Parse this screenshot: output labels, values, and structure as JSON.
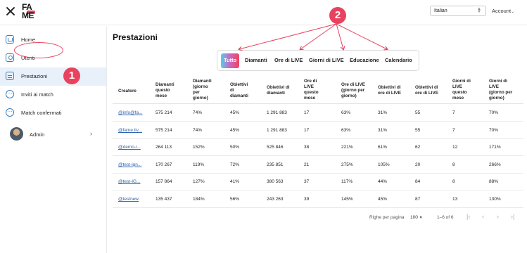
{
  "topbar": {
    "logo_line1": "FA",
    "logo_line2": "ME",
    "language_value": "Italian",
    "account_label": "Account"
  },
  "sidebar": {
    "items": [
      {
        "label": "Home",
        "icon": "home-icon"
      },
      {
        "label": "Utenti",
        "icon": "user-icon"
      },
      {
        "label": "Prestazioni",
        "icon": "document-icon"
      },
      {
        "label": "Inviti ai match",
        "icon": "chat-icon"
      },
      {
        "label": "Match confermati",
        "icon": "chat-icon"
      }
    ],
    "active_index": 2,
    "admin_label": "Admin"
  },
  "main": {
    "title": "Prestazioni",
    "tabs": [
      "Tutto",
      "Diamanti",
      "Ore di LIVE",
      "Giorni di LIVE",
      "Educazione",
      "Calendario"
    ],
    "active_tab": 0,
    "table": {
      "headers": [
        "Creatore",
        "Diamanti\nquesto\nmese",
        "Diamanti\n(giorno\nper\ngiorno)",
        "Obiettivi\ndi\ndiamanti",
        "Obiettivi di\ndiamanti",
        "Ore di\nLIVE\nquesto\nmese",
        "Ore di LIVE\n(giorno per\ngiorno)",
        "Obiettivi di\nore di LIVE",
        "Obiettivi di\nore di LIVE",
        "Giorni di\nLIVE\nquesto\nmese",
        "Giorni di\nLIVE\n(giorno per\ngiorno)"
      ],
      "rows": [
        [
          "@info@fa...",
          "575 214",
          "74%",
          "45%",
          "1 291 883",
          "17",
          "63%",
          "31%",
          "55",
          "7",
          "70%"
        ],
        [
          "@fame.liv...",
          "575 214",
          "74%",
          "45%",
          "1 291 883",
          "17",
          "63%",
          "31%",
          "55",
          "7",
          "70%"
        ],
        [
          "@demo-i...",
          "264 113",
          "152%",
          "50%",
          "525 846",
          "38",
          "221%",
          "61%",
          "62",
          "12",
          "171%"
        ],
        [
          "@test-ign...",
          "170 267",
          "119%",
          "72%",
          "235 851",
          "21",
          "275%",
          "105%",
          "20",
          "8",
          "266%"
        ],
        [
          "@test-IG...",
          "157 864",
          "127%",
          "41%",
          "380 563",
          "37",
          "117%",
          "44%",
          "84",
          "8",
          "88%"
        ],
        [
          "@testnew",
          "135 437",
          "184%",
          "56%",
          "243 263",
          "39",
          "145%",
          "45%",
          "87",
          "13",
          "130%"
        ]
      ]
    },
    "pagination": {
      "rows_per_page_label": "Righe per pagina",
      "rows_per_page_value": "100",
      "range": "1–6 of 6"
    }
  },
  "annotations": {
    "badge1": "1",
    "badge2": "2",
    "color": "#e8425f"
  }
}
